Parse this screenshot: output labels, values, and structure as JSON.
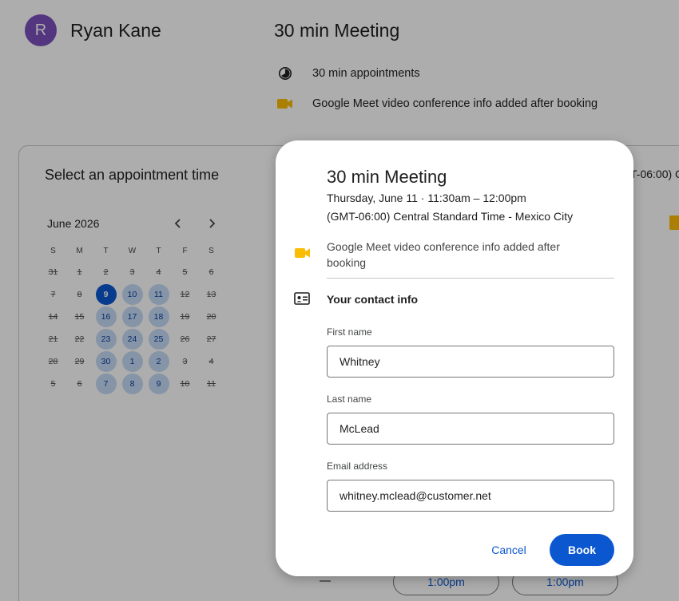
{
  "host": {
    "initial": "R",
    "name": "Ryan Kane",
    "avatar_color": "#7b4fbd"
  },
  "meeting": {
    "title": "30 min Meeting",
    "duration_text": "30 min appointments",
    "conference_text": "Google Meet video conference info added after booking"
  },
  "booking": {
    "section_title": "Select an appointment time",
    "timezone_partial": "T-06:00) C",
    "calendar": {
      "month_label": "June 2026",
      "prev_icon": "chevron-left-icon",
      "next_icon": "chevron-right-icon",
      "weekdays": [
        "S",
        "M",
        "T",
        "W",
        "T",
        "F",
        "S"
      ],
      "weeks": [
        [
          {
            "d": "31",
            "s": "disabled"
          },
          {
            "d": "1",
            "s": "disabled"
          },
          {
            "d": "2",
            "s": "disabled"
          },
          {
            "d": "3",
            "s": "disabled"
          },
          {
            "d": "4",
            "s": "disabled"
          },
          {
            "d": "5",
            "s": "disabled"
          },
          {
            "d": "6",
            "s": "disabled"
          }
        ],
        [
          {
            "d": "7",
            "s": "disabled"
          },
          {
            "d": "8",
            "s": "disabled"
          },
          {
            "d": "9",
            "s": "selected"
          },
          {
            "d": "10",
            "s": "available"
          },
          {
            "d": "11",
            "s": "available"
          },
          {
            "d": "12",
            "s": "disabled"
          },
          {
            "d": "13",
            "s": "disabled"
          }
        ],
        [
          {
            "d": "14",
            "s": "disabled"
          },
          {
            "d": "15",
            "s": "disabled"
          },
          {
            "d": "16",
            "s": "available"
          },
          {
            "d": "17",
            "s": "available"
          },
          {
            "d": "18",
            "s": "available"
          },
          {
            "d": "19",
            "s": "disabled"
          },
          {
            "d": "20",
            "s": "disabled"
          }
        ],
        [
          {
            "d": "21",
            "s": "disabled"
          },
          {
            "d": "22",
            "s": "disabled"
          },
          {
            "d": "23",
            "s": "available"
          },
          {
            "d": "24",
            "s": "available"
          },
          {
            "d": "25",
            "s": "available"
          },
          {
            "d": "26",
            "s": "disabled"
          },
          {
            "d": "27",
            "s": "disabled"
          }
        ],
        [
          {
            "d": "28",
            "s": "disabled"
          },
          {
            "d": "29",
            "s": "disabled"
          },
          {
            "d": "30",
            "s": "available"
          },
          {
            "d": "1",
            "s": "available"
          },
          {
            "d": "2",
            "s": "available"
          },
          {
            "d": "3",
            "s": "disabled"
          },
          {
            "d": "4",
            "s": "disabled"
          }
        ],
        [
          {
            "d": "5",
            "s": "disabled"
          },
          {
            "d": "6",
            "s": "disabled"
          },
          {
            "d": "7",
            "s": "available"
          },
          {
            "d": "8",
            "s": "available"
          },
          {
            "d": "9",
            "s": "available"
          },
          {
            "d": "10",
            "s": "disabled"
          },
          {
            "d": "11",
            "s": "disabled"
          }
        ]
      ]
    },
    "time_slots": [
      "1:00pm",
      "1:00pm"
    ]
  },
  "dialog": {
    "title": "30 min Meeting",
    "when": "Thursday, June 11 · 11:30am – 12:00pm",
    "timezone": "(GMT-06:00) Central Standard Time - Mexico City",
    "conference_note": "Google Meet video conference info added after booking",
    "contact_heading": "Your contact info",
    "fields": {
      "first_name": {
        "label": "First name",
        "value": "Whitney"
      },
      "last_name": {
        "label": "Last name",
        "value": "McLead"
      },
      "email": {
        "label": "Email address",
        "value": "whitney.mclead@customer.net"
      }
    },
    "cancel_label": "Cancel",
    "book_label": "Book"
  },
  "colors": {
    "accent": "#0b57d0",
    "meet_yellow": "#fbbc04",
    "available_day": "#c5dbf7",
    "scrim": "rgba(0,0,0,0.32)"
  }
}
